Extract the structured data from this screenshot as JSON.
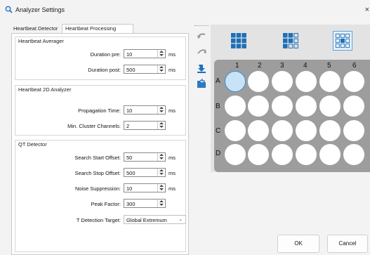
{
  "window": {
    "title": "Analyzer Settings",
    "close_glyph": "×"
  },
  "tabs": [
    {
      "label": "Heartbeat Detector",
      "active": false
    },
    {
      "label": "Heartbeat Processing",
      "active": true
    }
  ],
  "heartbeat_averager": {
    "title": "Heartbeat Averager",
    "fields": [
      {
        "label": "Duration pre:",
        "value": "10",
        "unit": "ms"
      },
      {
        "label": "Duration post:",
        "value": "500",
        "unit": "ms"
      }
    ]
  },
  "heartbeat_2d": {
    "title": "Heartbeat 2D Analyzer",
    "fields": [
      {
        "label": "Propagation Time:",
        "value": "10",
        "unit": "ms"
      },
      {
        "label": "Min. Cluster Channels:",
        "value": "2",
        "unit": ""
      }
    ]
  },
  "qt_detector": {
    "title": "QT Detector",
    "fields": [
      {
        "label": "Search Start Offset:",
        "value": "50",
        "unit": "ms"
      },
      {
        "label": "Search Stop Offset:",
        "value": "500",
        "unit": "ms"
      },
      {
        "label": "Noise Suppression:",
        "value": "10",
        "unit": "ms"
      },
      {
        "label": "Peak Factor:",
        "value": "300",
        "unit": ""
      }
    ],
    "t_detection": {
      "label": "T Detection Target:",
      "value": "Global Extremum"
    }
  },
  "plate": {
    "columns": [
      "1",
      "2",
      "3",
      "4",
      "5",
      "6"
    ],
    "rows": [
      "A",
      "B",
      "C",
      "D"
    ],
    "selected_well": "A1"
  },
  "buttons": {
    "ok": "OK",
    "cancel": "Cancel"
  },
  "colors": {
    "accent": "#1e6fb8",
    "selected_well": "#c8e3f8",
    "plate": "#9d9d9d"
  }
}
